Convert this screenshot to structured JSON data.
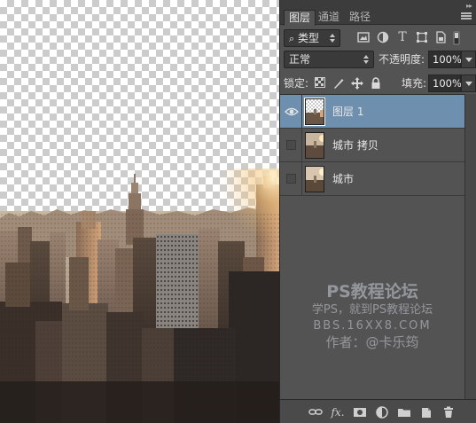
{
  "tabs": [
    {
      "label": "图层",
      "active": true
    },
    {
      "label": "通道",
      "active": false
    },
    {
      "label": "路径",
      "active": false
    }
  ],
  "filter": {
    "kind_label": "类型",
    "icons": [
      "image-filter-icon",
      "adjustment-filter-icon",
      "type-filter-icon",
      "shape-filter-icon",
      "smart-object-filter-icon",
      "filter-toggle-icon"
    ]
  },
  "blend": {
    "mode": "正常",
    "opacity_label": "不透明度:",
    "opacity_value": "100%"
  },
  "lock": {
    "label": "锁定:",
    "icons": [
      "lock-transparent-icon",
      "lock-image-icon",
      "lock-position-icon",
      "lock-all-icon"
    ],
    "fill_label": "填充:",
    "fill_value": "100%"
  },
  "layers": [
    {
      "name": "图层 1",
      "visible": true,
      "selected": true
    },
    {
      "name": "城市 拷贝",
      "visible": false,
      "selected": false
    },
    {
      "name": "城市",
      "visible": false,
      "selected": false
    }
  ],
  "watermark": {
    "title": "PS教程论坛",
    "subtitle": "学PS，就到PS教程论坛",
    "url": "BBS.16XX8.COM",
    "author": "作者：@卡乐筠"
  },
  "bottom_icons": [
    "link-layers-icon",
    "fx-icon",
    "add-mask-icon",
    "adjustment-layer-icon",
    "new-group-icon",
    "new-layer-icon",
    "delete-layer-icon"
  ],
  "colors": {
    "panel_bg": "#535353",
    "selected_layer": "#6e8fad",
    "field_bg": "#3a3a3a"
  }
}
